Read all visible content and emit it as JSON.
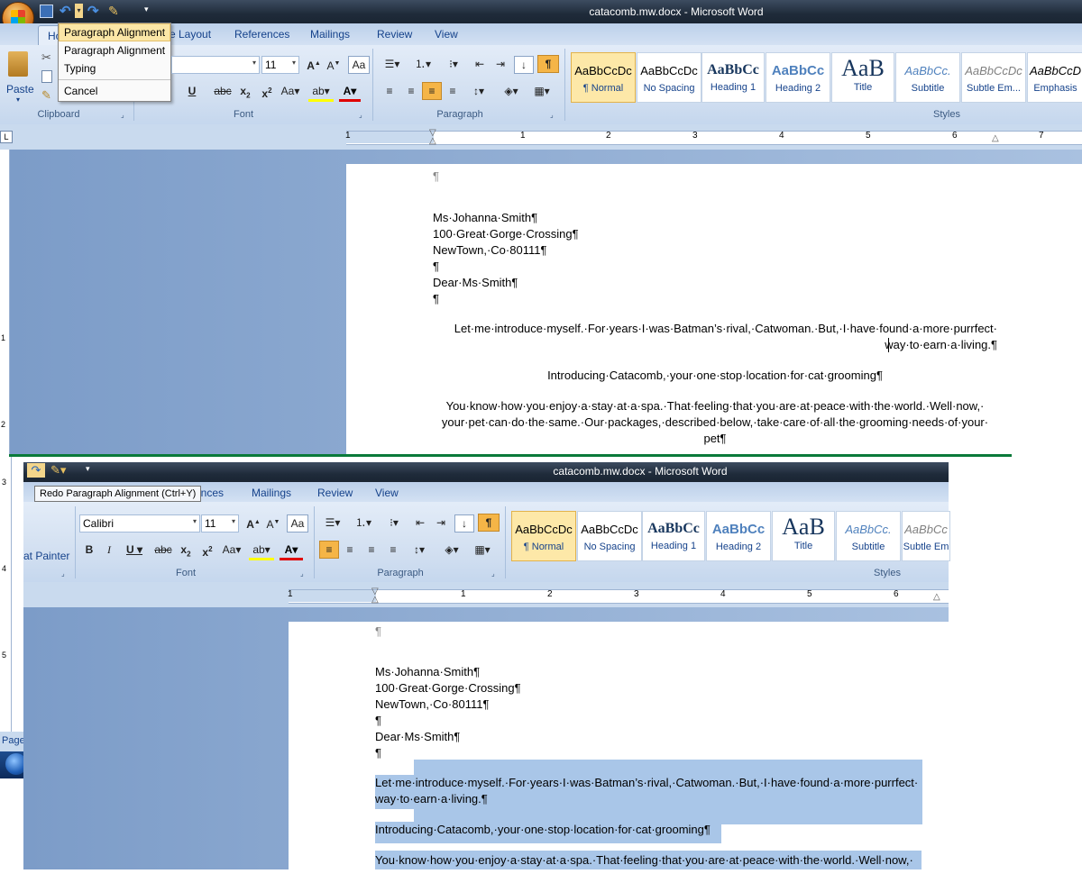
{
  "top_window": {
    "title": "catacomb.mw.docx - Microsoft Word",
    "tabs": [
      "Ho",
      "e Layout",
      "References",
      "Mailings",
      "Review",
      "View"
    ],
    "undo_menu": {
      "items": [
        "Paragraph Alignment",
        "Paragraph Alignment",
        "Typing"
      ],
      "cancel": "Cancel"
    },
    "clipboard": {
      "paste": "Paste",
      "label": "Clipboard"
    },
    "font": {
      "size": "11",
      "label": "Font"
    },
    "paragraph": {
      "label": "Paragraph"
    },
    "styles": {
      "label": "Styles",
      "items": [
        {
          "preview": "AaBbCcDc",
          "label": "¶ Normal"
        },
        {
          "preview": "AaBbCcDc",
          "label": "No Spacing"
        },
        {
          "preview": "AaBbCc",
          "label": "Heading 1"
        },
        {
          "preview": "AaBbCc",
          "label": "Heading 2"
        },
        {
          "preview": "AaB",
          "label": "Title"
        },
        {
          "preview": "AaBbCc.",
          "label": "Subtitle"
        },
        {
          "preview": "AaBbCcDc",
          "label": "Subtle Em..."
        },
        {
          "preview": "AaBbCcD",
          "label": "Emphasis"
        }
      ]
    },
    "ruler_numbers": [
      "1",
      "1",
      "2",
      "3",
      "4",
      "5",
      "6",
      "7"
    ],
    "document": {
      "empty_para": "¶",
      "lines": [
        "Ms·Johanna·Smith¶",
        "100·Great·Gorge·Crossing¶",
        "NewTown,·Co·80111¶",
        "¶",
        "Dear·Ms·Smith¶",
        "¶"
      ],
      "para1_line1": "Let·me·introduce·myself.·For·years·I·was·Batman’s·rival,·Catwoman.·But,·I·have·found·a·more·purrfect·",
      "para1_line2": "way·to·earn·a·living.¶",
      "para2": "Introducing·Catacomb,·your·one·stop·location·for·cat·grooming¶",
      "para3_line1": "You·know·how·you·enjoy·a·stay·at·a·spa.·That·feeling·that·you·are·at·peace·with·the·world.·Well·now,·",
      "para3_line2": "your·pet·can·do·the·same.·Our·packages,·described·below,·take·care·of·all·the·grooming·needs·of·your·",
      "para3_line3": "pet¶"
    }
  },
  "bottom_window": {
    "title": "catacomb.mw.docx - Microsoft Word",
    "tooltip": "Redo Paragraph Alignment (Ctrl+Y)",
    "tabs": [
      "ences",
      "Mailings",
      "Review",
      "View"
    ],
    "format_painter": "at Painter",
    "font_name": "Calibri",
    "font_size": "11",
    "font_label": "Font",
    "paragraph_label": "Paragraph",
    "styles_label": "Styles",
    "styles": [
      {
        "preview": "AaBbCcDc",
        "label": "¶ Normal"
      },
      {
        "preview": "AaBbCcDc",
        "label": "No Spacing"
      },
      {
        "preview": "AaBbCc",
        "label": "Heading 1"
      },
      {
        "preview": "AaBbCc",
        "label": "Heading 2"
      },
      {
        "preview": "AaB",
        "label": "Title"
      },
      {
        "preview": "AaBbCc.",
        "label": "Subtitle"
      },
      {
        "preview": "AaBbCc",
        "label": "Subtle Em"
      }
    ],
    "ruler_numbers": [
      "1",
      "1",
      "2",
      "3",
      "4",
      "5",
      "6"
    ],
    "vruler_numbers": [
      "3",
      "4",
      "5"
    ],
    "page_label": "Page",
    "document": {
      "lines": [
        "Ms·Johanna·Smith¶",
        "100·Great·Gorge·Crossing¶",
        "NewTown,·Co·80111¶",
        "¶",
        "Dear·Ms·Smith¶",
        "¶"
      ],
      "para1_line1": "Let·me·introduce·myself.·For·years·I·was·Batman’s·rival,·Catwoman.·But,·I·have·found·a·more·purrfect·",
      "para1_line2": "way·to·earn·a·living.¶",
      "para2": "Introducing·Catacomb,·your·one·stop·location·for·cat·grooming¶",
      "para3_line1": "You·know·how·you·enjoy·a·stay·at·a·spa.·That·feeling·that·you·are·at·peace·with·the·world.·Well·now,·"
    }
  },
  "left_ruler_numbers": [
    "1",
    "2"
  ],
  "colors": {
    "accent": "#15428b",
    "ribbon": "#d0def0",
    "selection": "#a9c6e8",
    "divider": "#0a7a3a"
  }
}
